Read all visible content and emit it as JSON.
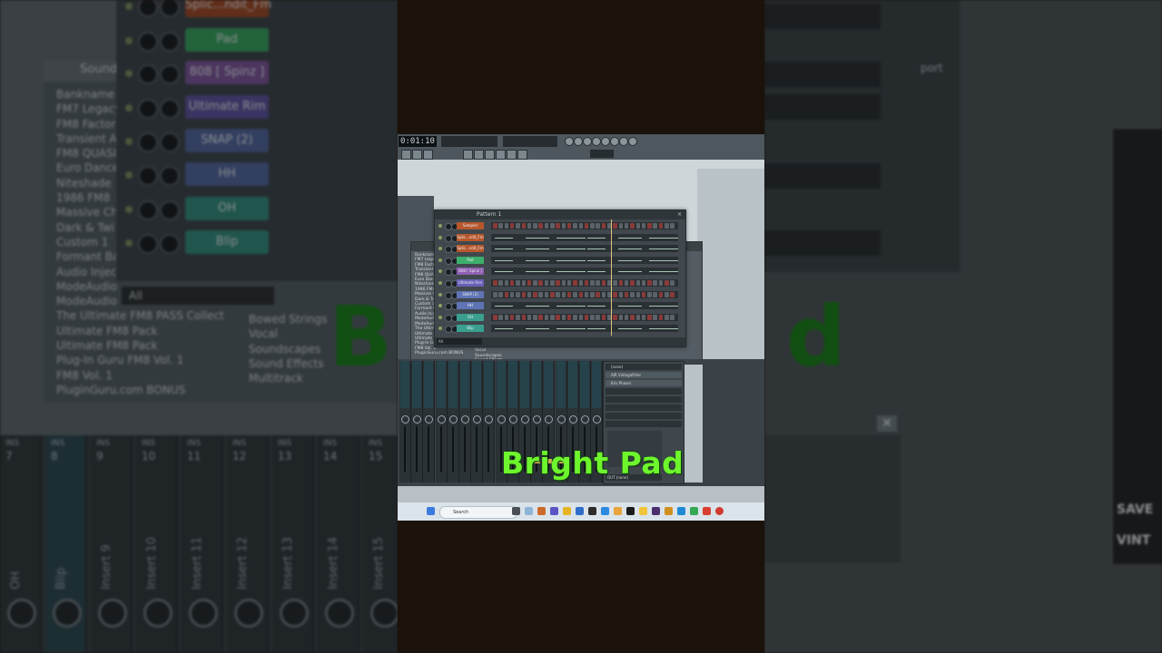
{
  "overlay": {
    "title": "Bright Pad",
    "ghost_left": "B",
    "ghost_right": "d"
  },
  "channel_rack": {
    "title": "Pattern 1",
    "filter": "All",
    "channels": [
      {
        "name": "Sampler",
        "color": "#b7572c"
      },
      {
        "name": "Splic...ndit_Fm",
        "color": "#b7572c"
      },
      {
        "name": "Splic...ndit_Fm",
        "color": "#b7572c"
      },
      {
        "name": "Pad",
        "color": "#3dae6c"
      },
      {
        "name": "808 [ Spinz ]",
        "color": "#8f5fb1"
      },
      {
        "name": "Ultimate Rim",
        "color": "#6a5fb7"
      },
      {
        "name": "SNAP (2)",
        "color": "#5f74b5"
      },
      {
        "name": "HH",
        "color": "#5f74b5"
      },
      {
        "name": "OH",
        "color": "#3a9f8f"
      },
      {
        "name": "Blip",
        "color": "#3a9f8f"
      }
    ]
  },
  "transport": {
    "time": "0:01:10"
  },
  "browser": {
    "tab": "Sounds",
    "banks": [
      "Bankname",
      "FM7 Legacy",
      "FM8 Factory",
      "Transient A",
      "FM8 QUASI",
      "Euro Dance",
      "Niteshade",
      "1986 FM8",
      "Massive Ch",
      "Dark & Twi",
      "Custom 1",
      "Formant Ba",
      "Audio Inject",
      "ModeAudio",
      "ModeAudio",
      "The Ultimate FM8 PASS Collect",
      "Ultimate FM8 Pack",
      "Ultimate FM8 Pack",
      "Plug-In Guru FM8 Vol. 1",
      "FM8 Vol. 1",
      "PluginGuru.com BONUS"
    ],
    "categories": [
      "Bowed Strings",
      "Vocal",
      "Soundscapes",
      "Sound Effects",
      "Multitrack"
    ],
    "filter": "All"
  },
  "mixer": {
    "inserts": [
      "INS",
      "INS",
      "INS",
      "INS",
      "INS",
      "INS",
      "INS",
      "INS",
      "INS"
    ],
    "insert_numbers": [
      "7",
      "8",
      "9",
      "10",
      "11",
      "12",
      "13",
      "14",
      "15"
    ],
    "insert_names": [
      "OH",
      "Blip",
      "Insert 9",
      "Insert 10",
      "Insert 11",
      "Insert 12",
      "Insert 13",
      "Insert 14",
      "Insert 15"
    ],
    "slot_header": "(none)",
    "slots": [
      "AIR VintageFilter",
      "Kris Phaser",
      "",
      "",
      "",
      "",
      "",
      ""
    ],
    "out_label": "OUT",
    "out_value": "(none)"
  },
  "right_panel": {
    "save_label": "SAVE",
    "vint_label": "VINT",
    "export_label": "port"
  },
  "taskbar": {
    "search_placeholder": "Search"
  }
}
